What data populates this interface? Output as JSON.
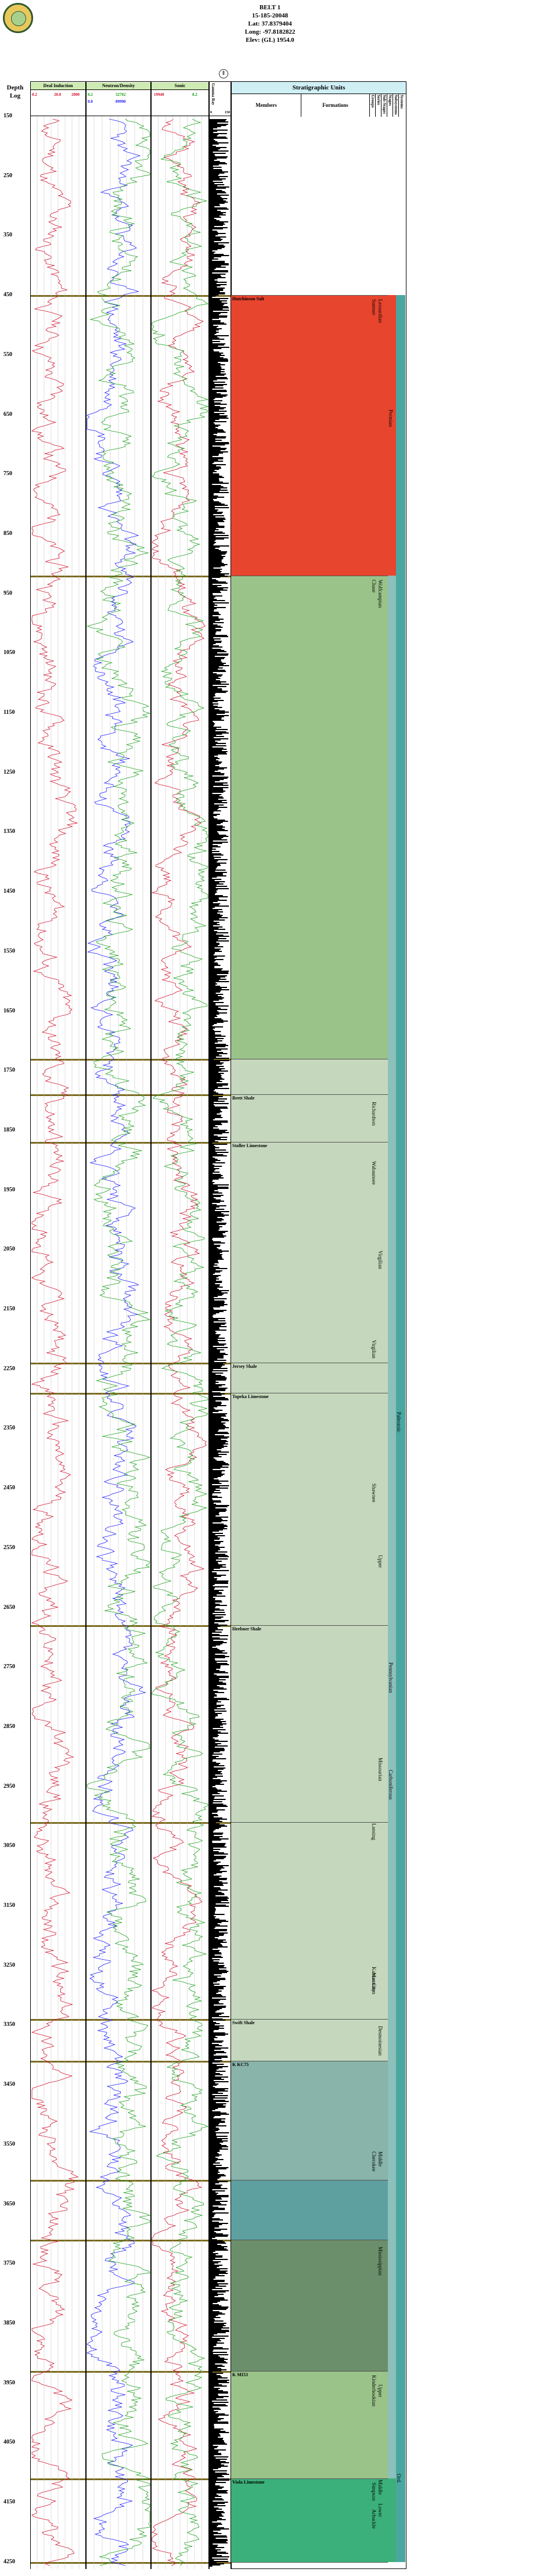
{
  "header": {
    "well_name": "BELT 1",
    "api": "15-185-20048",
    "lat": "Lat: 37.8379404",
    "long": "Long: -97.8182822",
    "elev": "Elev: (GL) 1954.0",
    "nav_icon": "up-down-arrows-icon"
  },
  "columns": {
    "depth_title": "Depth",
    "depth_sub": "Log",
    "track1_title": "Deal Induction",
    "track1_scale_left": "0.2",
    "track1_scale_mid": "20.0",
    "track1_scale_right": "2000",
    "track1_scale_r2": "0.2",
    "track2_title": "Neutron/Density",
    "track2_s1": "0.2",
    "track2_s2": "0.4",
    "track2_s3": "32702",
    "track2_s4": "0.0",
    "track2_s5": "0.0",
    "track2_s6": "89990",
    "track3_title": "Sonic",
    "track3_s1": "8.2",
    "track3_s2": "19940",
    "track3_s3": "0.3",
    "track3_s4": "8.2",
    "track4_title": "Gamma Ray",
    "track4_s1": "0",
    "track4_s2": "150",
    "strat_title": "Stratigraphic Units",
    "members_title": "Members",
    "formations_title": "Formations",
    "rank_cols": [
      "Groups",
      "Series",
      "Sub-Stages",
      "Stages",
      "Subsystems",
      "Systems"
    ]
  },
  "depths": [
    "150",
    "250",
    "350",
    "450",
    "550",
    "650",
    "750",
    "850",
    "950",
    "1050",
    "1150",
    "1250",
    "1350",
    "1450",
    "1550",
    "1650",
    "1750",
    "1850",
    "1950",
    "2050",
    "2150",
    "2250",
    "2350",
    "2450",
    "2550",
    "2650",
    "2750",
    "2850",
    "2950",
    "3050",
    "3150",
    "3250",
    "3350",
    "3450",
    "3550",
    "3650",
    "3750",
    "3850",
    "3950",
    "4050",
    "4150",
    "4250"
  ],
  "members": [
    {
      "label": "Hutchinson Salt"
    },
    {
      "label": "Brett Shale"
    },
    {
      "label": "Stoller Limestone"
    },
    {
      "label": "Jersey Shale"
    },
    {
      "label": "Topeka Limestone"
    },
    {
      "label": "Heebner Shale"
    },
    {
      "label": "Swift Shale"
    },
    {
      "label": "K KC75"
    },
    {
      "label": "K MI53"
    },
    {
      "label": "Viola Limestone"
    }
  ],
  "formations": [
    "Wellington",
    "Chase",
    "Wabaunsee",
    "Shawnee",
    "Lansing",
    "Kansas City",
    "Cherokee"
  ],
  "groups": [
    {
      "label": "Sumner"
    },
    {
      "label": "Chase"
    },
    {
      "label": "Richardson"
    },
    {
      "label": "Wabaunsee"
    },
    {
      "label": "Virgilian"
    },
    {
      "label": "Shawnee"
    },
    {
      "label": "Lansing"
    },
    {
      "label": "Kansas City"
    },
    {
      "label": "Marmaton"
    },
    {
      "label": "Cherokee"
    },
    {
      "label": "Kinderhookian"
    },
    {
      "label": "Simpson"
    },
    {
      "label": "Arbuckle"
    }
  ],
  "series": [
    {
      "label": "Leonardian"
    },
    {
      "label": "Wolfcampian"
    },
    {
      "label": "Virgilian"
    },
    {
      "label": "Upper"
    },
    {
      "label": "Missourian"
    },
    {
      "label": "Desmoinesian"
    },
    {
      "label": "Middle"
    },
    {
      "label": "Mississippian"
    },
    {
      "label": "Upper"
    },
    {
      "label": "Middle"
    },
    {
      "label": "Lower"
    }
  ],
  "systems": [
    {
      "label": "Permian"
    },
    {
      "label": "Pennsylvanian"
    },
    {
      "label": "Carboniferous"
    },
    {
      "label": "Paleozoic"
    },
    {
      "label": "Ord."
    }
  ],
  "colors": {
    "permian": "#e8452e",
    "pennsylvanian_light": "#9ac38a",
    "pennsylvanian_upper": "#c5d8bd",
    "middle": "#88b4aa",
    "middle2": "#5ea0a0",
    "mississippian": "#6b8f6a",
    "ordovician": "#3cb07a",
    "paleozoic": "#8cc0ba",
    "resistivity": "#d0102a",
    "neutron": "#1a1aff",
    "density": "#18a018",
    "gamma": "#000000"
  }
}
